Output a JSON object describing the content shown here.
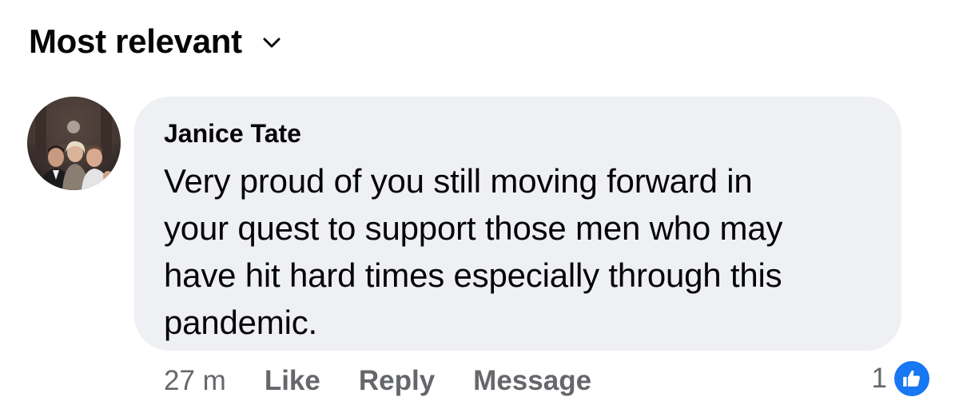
{
  "sort": {
    "label": "Most relevant",
    "icon": "chevron-down-icon"
  },
  "comment": {
    "author": "Janice Tate",
    "text": "Very proud of you still moving forward in your quest to support those men who may have hit hard times especially through this pandemic.",
    "lines": [
      "Very proud of you still moving forward in",
      "your quest to support those men who may",
      "have hit hard times especially through this",
      "pandemic."
    ],
    "bubble_color": "#eff0f4"
  },
  "actions": {
    "timestamp": "27 m",
    "like_label": "Like",
    "reply_label": "Reply",
    "message_label": "Message",
    "text_color": "#65676b"
  },
  "reactions": {
    "count": "1",
    "icon": "thumbs-up-icon",
    "accent": "#1877f2"
  }
}
